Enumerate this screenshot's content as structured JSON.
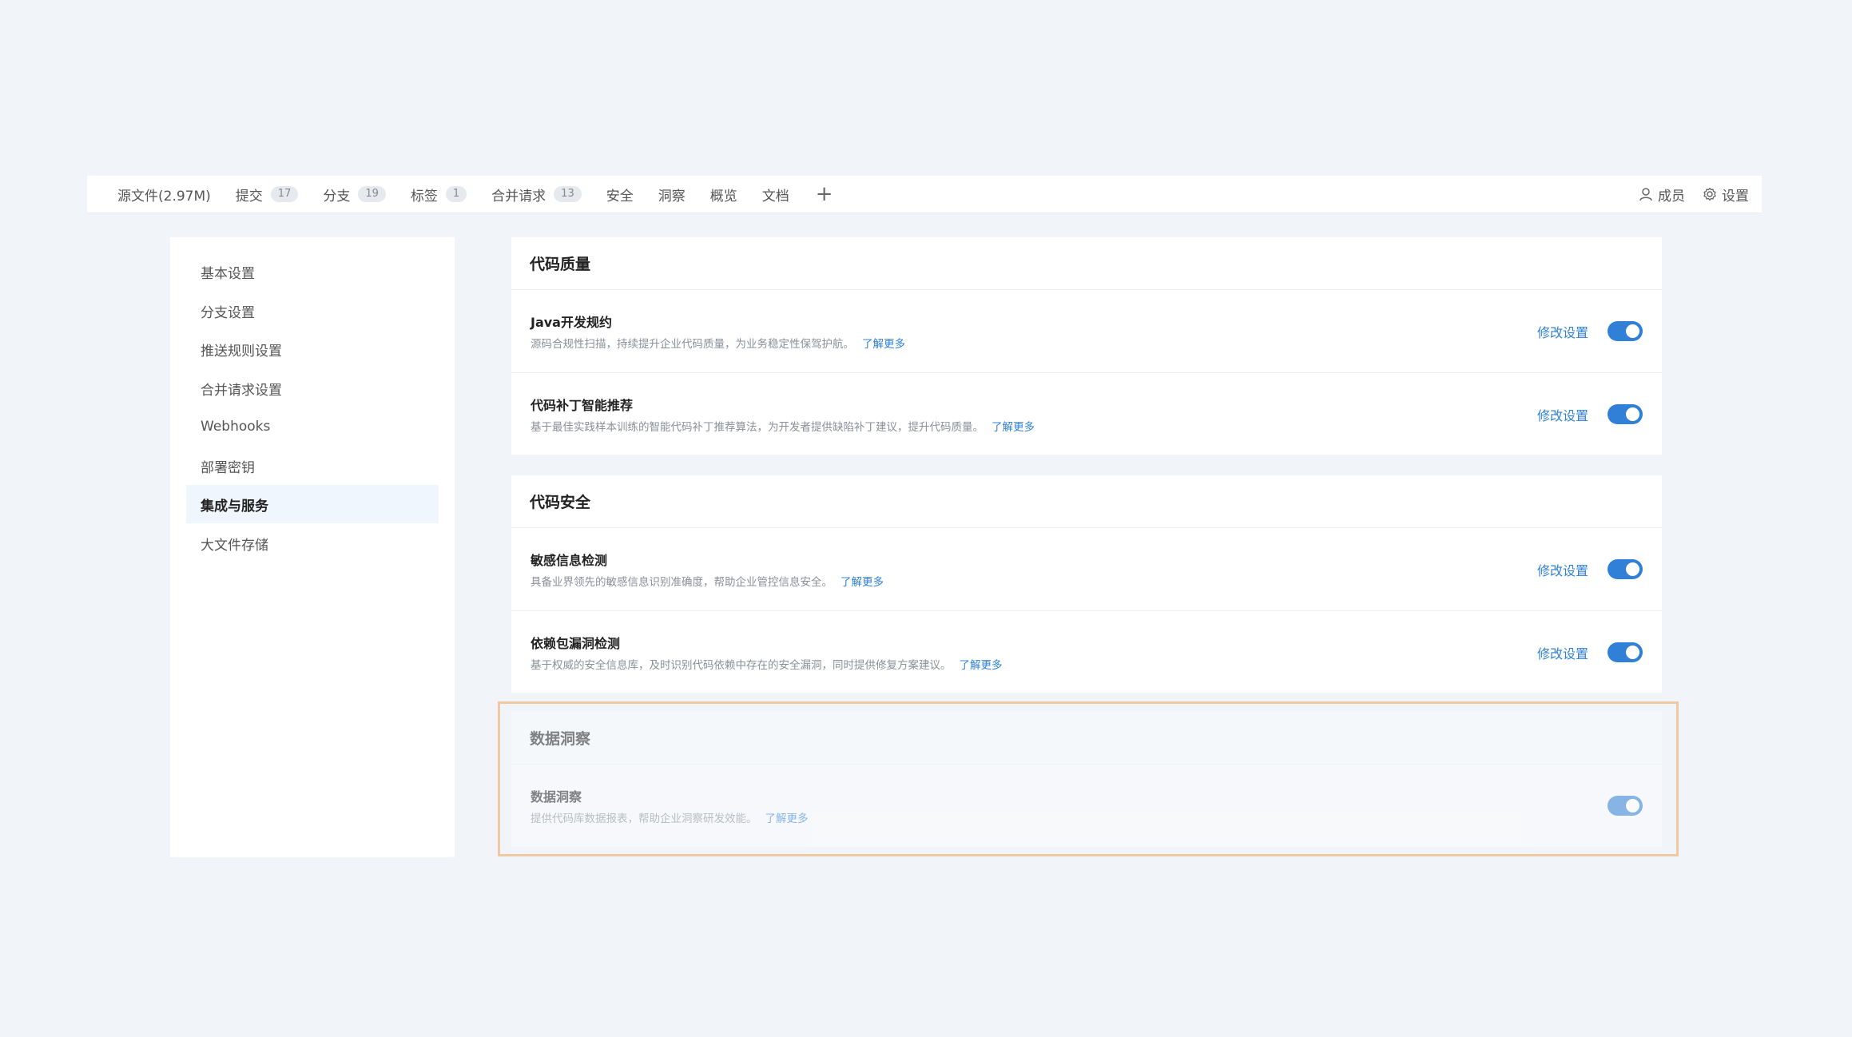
{
  "nav": {
    "tabs": [
      {
        "label": "源文件(2.97M)",
        "badge": ""
      },
      {
        "label": "提交",
        "badge": "17"
      },
      {
        "label": "分支",
        "badge": "19"
      },
      {
        "label": "标签",
        "badge": "1"
      },
      {
        "label": "合并请求",
        "badge": "13"
      },
      {
        "label": "安全",
        "badge": ""
      },
      {
        "label": "洞察",
        "badge": ""
      },
      {
        "label": "概览",
        "badge": ""
      },
      {
        "label": "文档",
        "badge": ""
      }
    ],
    "plus": "+",
    "members": "成员",
    "settings": "设置"
  },
  "sidebar": {
    "items": [
      {
        "label": "基本设置"
      },
      {
        "label": "分支设置"
      },
      {
        "label": "推送规则设置"
      },
      {
        "label": "合并请求设置"
      },
      {
        "label": "Webhooks"
      },
      {
        "label": "部署密钥"
      },
      {
        "label": "集成与服务"
      },
      {
        "label": "大文件存储"
      }
    ],
    "active_index": 6
  },
  "sections": [
    {
      "title": "代码质量",
      "items": [
        {
          "name": "Java开发规约",
          "desc": "源码合规性扫描，持续提升企业代码质量，为业务稳定性保驾护航。",
          "learn": "了解更多",
          "modify": "修改设置",
          "enabled": true
        },
        {
          "name": "代码补丁智能推荐",
          "desc": "基于最佳实践样本训练的智能代码补丁推荐算法，为开发者提供缺陷补丁建议，提升代码质量。",
          "learn": "了解更多",
          "modify": "修改设置",
          "enabled": true
        }
      ]
    },
    {
      "title": "代码安全",
      "items": [
        {
          "name": "敏感信息检测",
          "desc": "具备业界领先的敏感信息识别准确度，帮助企业管控信息安全。",
          "learn": "了解更多",
          "modify": "修改设置",
          "enabled": true
        },
        {
          "name": "依赖包漏洞检测",
          "desc": "基于权威的安全信息库，及时识别代码依赖中存在的安全漏洞，同时提供修复方案建议。",
          "learn": "了解更多",
          "modify": "修改设置",
          "enabled": true
        }
      ]
    },
    {
      "title": "数据洞察",
      "items": [
        {
          "name": "数据洞察",
          "desc": "提供代码库数据报表，帮助企业洞察研发效能。",
          "learn": "了解更多",
          "modify": "",
          "enabled": true
        }
      ]
    }
  ],
  "colors": {
    "accent": "#2f80d6",
    "highlight_border": "#f0c9a3",
    "background": "#f1f5f9"
  }
}
